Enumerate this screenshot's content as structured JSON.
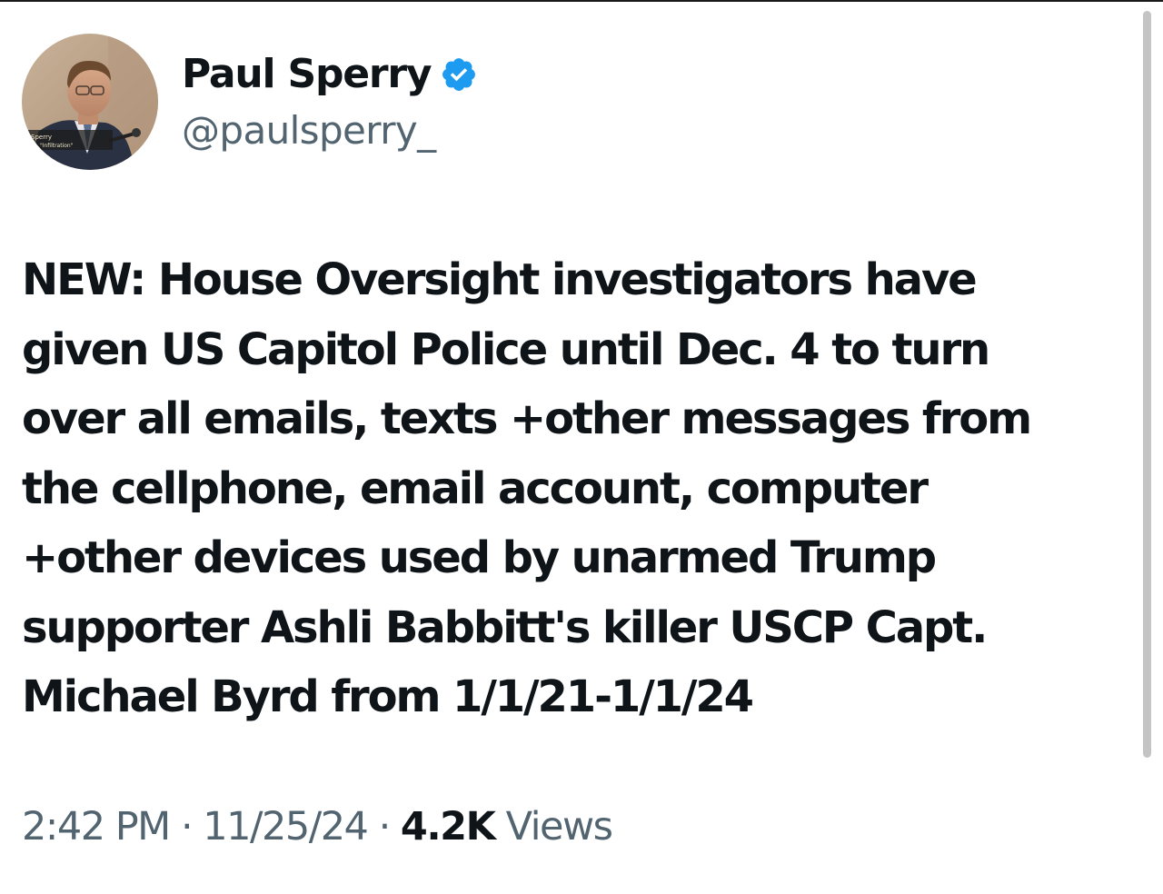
{
  "author": {
    "display_name": "Paul Sperry",
    "handle": "@paulsperry_",
    "verified_icon": "verified-badge-icon",
    "avatar_caption_line1": "Sperry",
    "avatar_caption_line2": "or, \"Infiltration\""
  },
  "tweet": {
    "lines": [
      "NEW: House Oversight investigators have",
      "given US Capitol Police until Dec. 4 to turn",
      "over all emails, texts +other messages from",
      "the cellphone, email account, computer",
      "+other devices used by unarmed Trump",
      "supporter Ashli Babbitt's killer USCP Capt.",
      "Michael Byrd from 1/1/21-1/1/24"
    ]
  },
  "meta": {
    "time": "2:42 PM",
    "separator": "·",
    "date": "11/25/24",
    "views_count": "4.2K",
    "views_label": "Views"
  },
  "colors": {
    "verified_blue": "#1d9bf0",
    "secondary_text": "#536471",
    "primary_text": "#0f1419"
  }
}
